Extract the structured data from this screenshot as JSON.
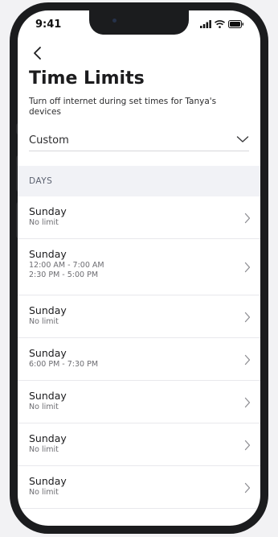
{
  "status_bar": {
    "time": "9:41",
    "icons": [
      "signal-icon",
      "wifi-icon",
      "battery-icon"
    ]
  },
  "header": {
    "back_icon": "chevron-left-icon",
    "title": "Time Limits",
    "subtitle": "Turn off internet during set times for Tanya's devices"
  },
  "schedule_select": {
    "value": "Custom",
    "icon": "chevron-down-icon"
  },
  "days_section": {
    "label": "DAYS",
    "items": [
      {
        "name": "Sunday",
        "details": [
          "No limit"
        ]
      },
      {
        "name": "Sunday",
        "details": [
          "12:00 AM - 7:00 AM",
          "2:30 PM - 5:00 PM"
        ]
      },
      {
        "name": "Sunday",
        "details": [
          "No limit"
        ]
      },
      {
        "name": "Sunday",
        "details": [
          "6:00 PM - 7:30 PM"
        ]
      },
      {
        "name": "Sunday",
        "details": [
          "No limit"
        ]
      },
      {
        "name": "Sunday",
        "details": [
          "No limit"
        ]
      },
      {
        "name": "Sunday",
        "details": [
          "No limit"
        ]
      }
    ]
  },
  "colors": {
    "frame": "#1b1c1e",
    "screen": "#ffffff",
    "section_bg": "#f1f2f6",
    "text_primary": "#1c1c1e",
    "text_secondary": "#6d6d72",
    "chevron": "#8e8e93"
  }
}
